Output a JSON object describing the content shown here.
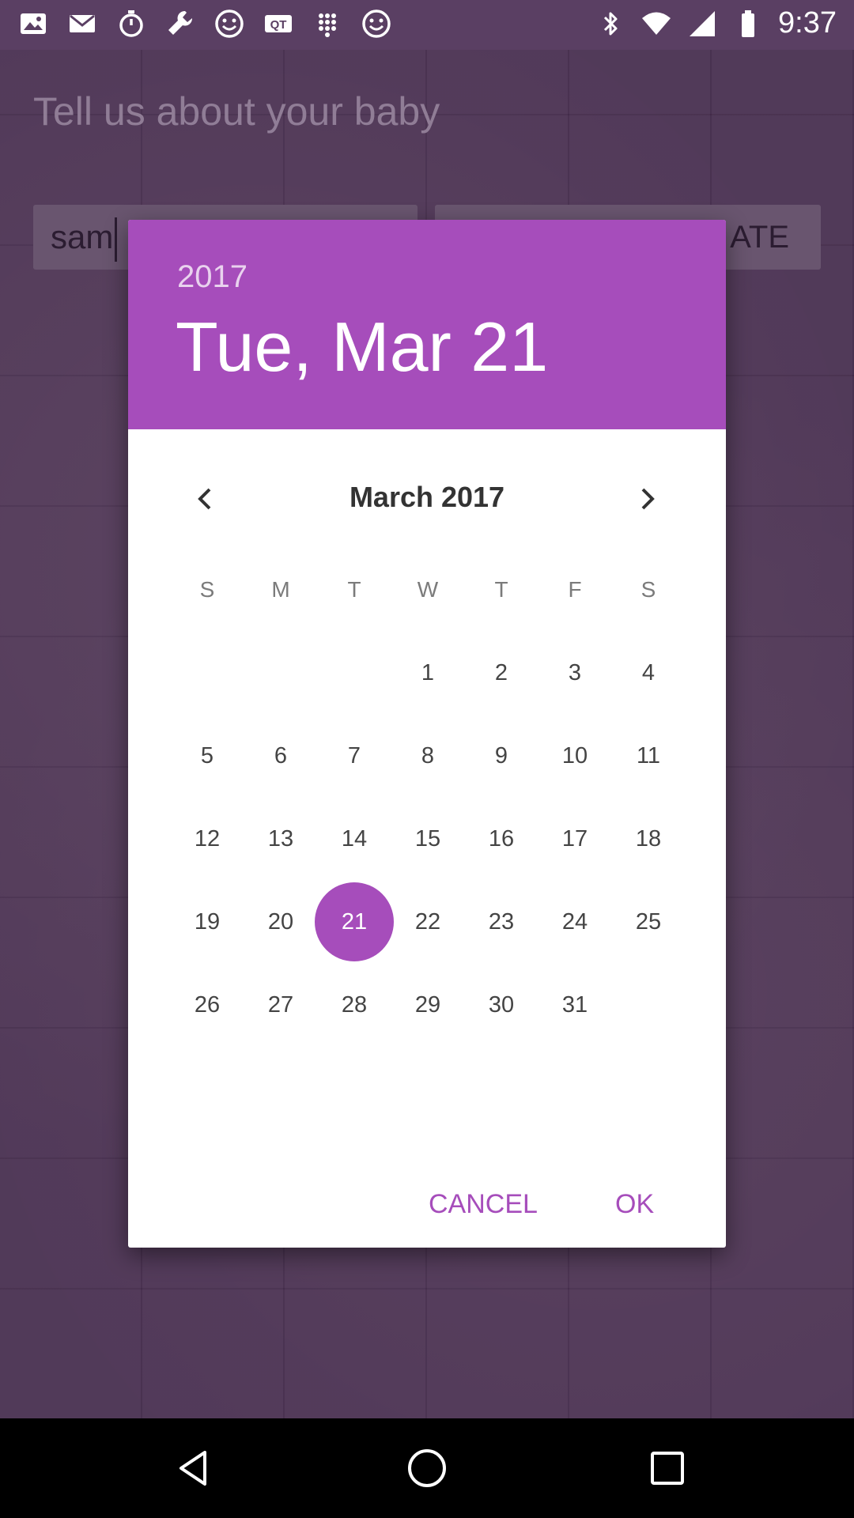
{
  "status_bar": {
    "time": "9:37",
    "left_icons": [
      "photos-icon",
      "email-icon",
      "timer-icon",
      "wrench-icon",
      "smiley-icon",
      "qt-icon",
      "dialpad-icon",
      "smiley-icon"
    ],
    "right_icons": [
      "bluetooth-icon",
      "wifi-icon",
      "signal-icon",
      "battery-icon"
    ]
  },
  "app": {
    "heading": "Tell us about your baby",
    "name_input_value": "sam",
    "date_button_label": "ATE"
  },
  "date_picker": {
    "year": "2017",
    "selected_date": "Tue, Mar 21",
    "month_title": "March 2017",
    "weekday_headers": [
      "S",
      "M",
      "T",
      "W",
      "T",
      "F",
      "S"
    ],
    "first_day_column": 3,
    "days": [
      "1",
      "2",
      "3",
      "4",
      "5",
      "6",
      "7",
      "8",
      "9",
      "10",
      "11",
      "12",
      "13",
      "14",
      "15",
      "16",
      "17",
      "18",
      "19",
      "20",
      "21",
      "22",
      "23",
      "24",
      "25",
      "26",
      "27",
      "28",
      "29",
      "30",
      "31"
    ],
    "selected_day": "21",
    "cancel_label": "CANCEL",
    "ok_label": "OK"
  },
  "colors": {
    "accent": "#a64dbb",
    "dialog_bg": "#ffffff",
    "status_bar": "#5a3f63",
    "nav_bar": "#000000"
  },
  "nav_bar": {
    "icons": [
      "back-icon",
      "home-icon",
      "recents-icon"
    ]
  }
}
